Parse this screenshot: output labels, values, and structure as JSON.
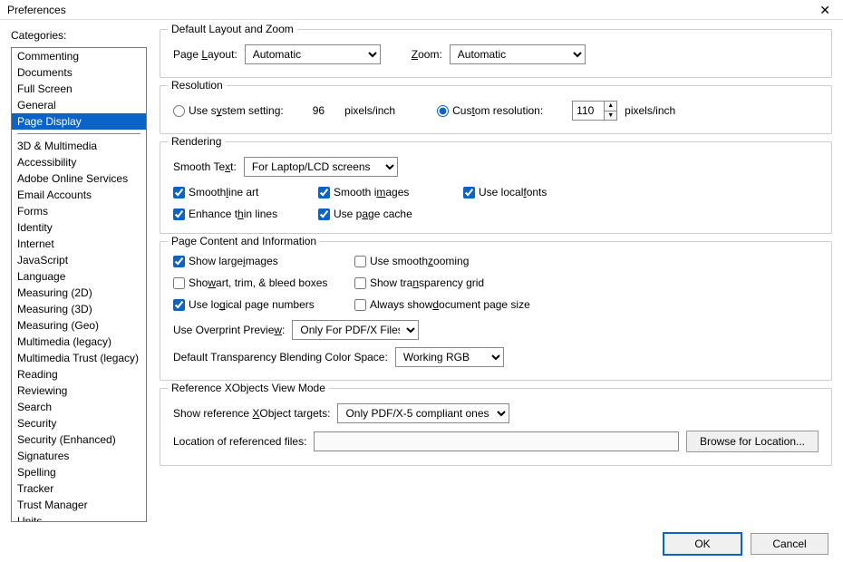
{
  "window": {
    "title": "Preferences"
  },
  "sidebar": {
    "header": "Categories:",
    "items_top": [
      "Commenting",
      "Documents",
      "Full Screen",
      "General",
      "Page Display"
    ],
    "items_bottom": [
      "3D & Multimedia",
      "Accessibility",
      "Adobe Online Services",
      "Email Accounts",
      "Forms",
      "Identity",
      "Internet",
      "JavaScript",
      "Language",
      "Measuring (2D)",
      "Measuring (3D)",
      "Measuring (Geo)",
      "Multimedia (legacy)",
      "Multimedia Trust (legacy)",
      "Reading",
      "Reviewing",
      "Search",
      "Security",
      "Security (Enhanced)",
      "Signatures",
      "Spelling",
      "Tracker",
      "Trust Manager",
      "Units"
    ],
    "selected": "Page Display"
  },
  "groups": {
    "layout": {
      "title": "Default Layout and Zoom",
      "page_layout_label": "Page Layout:",
      "page_layout_value": "Automatic",
      "zoom_label": "Zoom:",
      "zoom_value": "Automatic"
    },
    "resolution": {
      "title": "Resolution",
      "use_system_label": "Use system setting:",
      "system_value": "96",
      "system_unit": "pixels/inch",
      "custom_label": "Custom resolution:",
      "custom_value": "110",
      "custom_unit": "pixels/inch"
    },
    "rendering": {
      "title": "Rendering",
      "smooth_text_label": "Smooth Text:",
      "smooth_text_value": "For Laptop/LCD screens",
      "chk_smooth_line_art": "Smooth line art",
      "chk_smooth_images": "Smooth images",
      "chk_use_local_fonts": "Use local fonts",
      "chk_enhance_thin": "Enhance thin lines",
      "chk_use_page_cache": "Use page cache"
    },
    "content": {
      "title": "Page Content and Information",
      "chk_large_images": "Show large images",
      "chk_smooth_zoom": "Use smooth zooming",
      "chk_art_trim": "Show art, trim, & bleed boxes",
      "chk_transparency_grid": "Show transparency grid",
      "chk_logical_page": "Use logical page numbers",
      "chk_always_doc_size": "Always show document page size",
      "overprint_label": "Use Overprint Preview:",
      "overprint_value": "Only For PDF/X Files",
      "blend_label": "Default Transparency Blending Color Space:",
      "blend_value": "Working RGB"
    },
    "xobjects": {
      "title": "Reference XObjects View Mode",
      "targets_label": "Show reference XObject targets:",
      "targets_value": "Only PDF/X-5 compliant ones",
      "location_label": "Location of referenced files:",
      "location_value": "",
      "browse_label": "Browse for Location..."
    }
  },
  "footer": {
    "ok": "OK",
    "cancel": "Cancel"
  }
}
